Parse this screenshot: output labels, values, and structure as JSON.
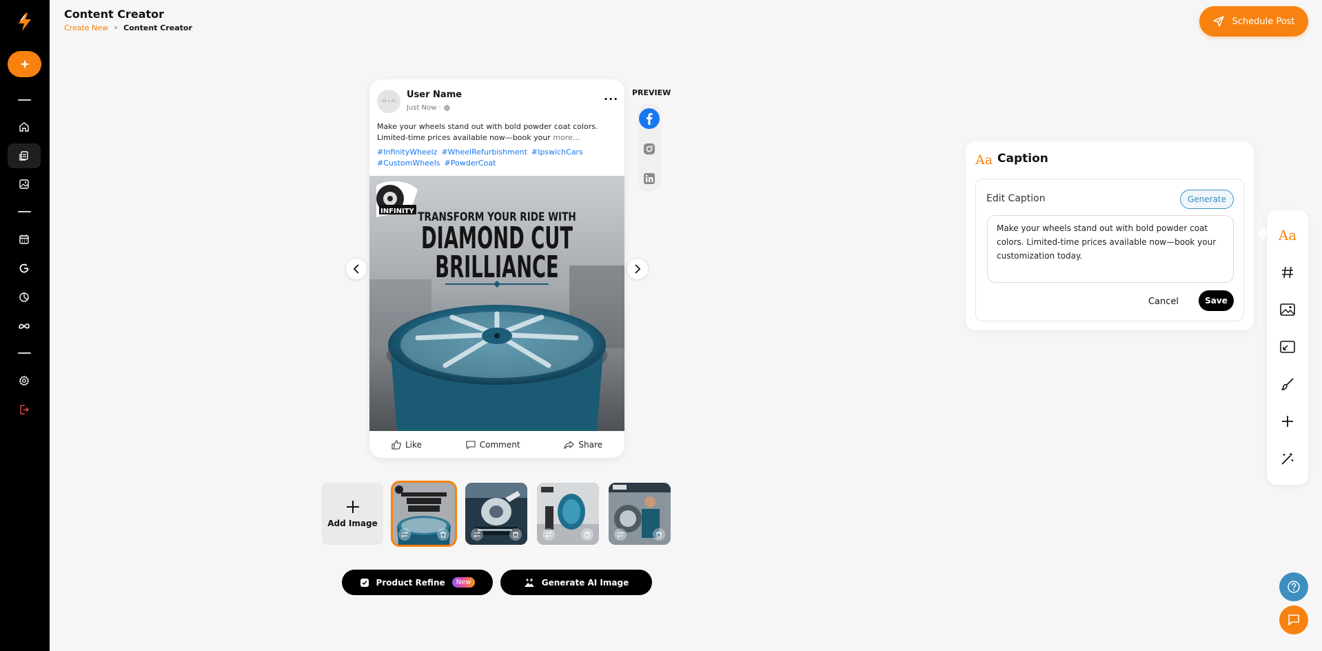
{
  "header": {
    "title": "Content Creator",
    "breadcrumb": {
      "link": "Create New",
      "separator": "»",
      "current": "Content Creator"
    },
    "schedule_button": "Schedule Post"
  },
  "colors": {
    "accent": "#f7820f",
    "sidebar": "#000000",
    "facebook": "#1877f2",
    "hashtag": "#1877f2",
    "help": "#3d8fbf"
  },
  "sidebar": {
    "icons": [
      "logo-bolt-icon",
      "new-sparkle-icon",
      "home-icon",
      "content-icon",
      "gallery-icon",
      "calendar-icon",
      "google-icon",
      "analytics-icon",
      "meta-icon",
      "settings-icon",
      "logout-icon"
    ]
  },
  "post": {
    "user_name": "User Name",
    "time": "Just Now ·",
    "avatar_text": "49 × 49",
    "text": "Make your wheels stand out with bold powder coat colors. Limited-time prices available now—book your",
    "more": "more...",
    "hashtags": [
      "#InfinityWheelz",
      "#WheelRefurbishment",
      "#IpswichCars",
      "#CustomWheels",
      "#PowderCoat"
    ],
    "image": {
      "brand": "INFINITY",
      "line1": "TRANSFORM YOUR RIDE WITH",
      "line2": "DIAMOND CUT",
      "line3": "BRILLIANCE"
    },
    "actions": {
      "like": "Like",
      "comment": "Comment",
      "share": "Share"
    }
  },
  "preview": {
    "label": "PREVIEW",
    "platforms": [
      "facebook-icon",
      "instagram-icon",
      "linkedin-icon"
    ],
    "selected": "facebook"
  },
  "thumbnails": {
    "add_label": "Add Image",
    "items": [
      {
        "name": "thumb-diamond-cut",
        "selected": true
      },
      {
        "name": "thumb-wheel-spray",
        "selected": false
      },
      {
        "name": "thumb-wheel-studio",
        "selected": false
      },
      {
        "name": "thumb-mechanic",
        "selected": false
      }
    ]
  },
  "buttons": {
    "product_refine": "Product Refine",
    "new_badge": "New",
    "generate_ai_image": "Generate AI Image"
  },
  "caption_panel": {
    "icon": "Aa",
    "title": "Caption",
    "edit_label": "Edit Caption",
    "generate": "Generate",
    "caption_value": "Make your wheels stand out with bold powder coat colors. Limited-time prices available now—book your customization today.",
    "cancel": "Cancel",
    "save": "Save"
  },
  "toolbar": {
    "caption_icon_text": "Aa",
    "items": [
      "caption-icon",
      "hashtag-icon",
      "image-icon",
      "resize-icon",
      "brush-icon",
      "plus-icon",
      "magic-wand-icon"
    ],
    "active": "caption-icon"
  }
}
